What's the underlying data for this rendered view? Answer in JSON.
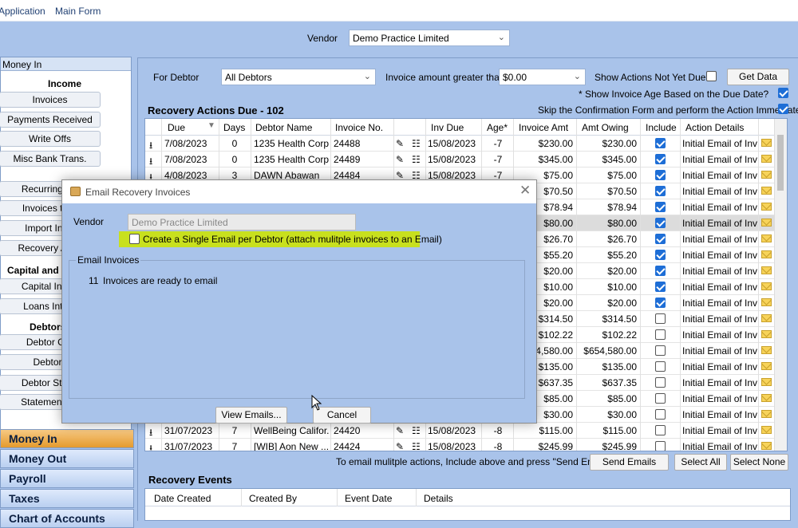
{
  "menubar": {
    "items": [
      "Application",
      "Main Form"
    ]
  },
  "vendor": {
    "label": "Vendor",
    "value": "Demo Practice Limited"
  },
  "sidebar": {
    "header": "Money In",
    "sections": [
      {
        "title": "Income",
        "items": [
          "Invoices",
          "Payments Received",
          "Write Offs",
          "Misc Bank Trans."
        ]
      },
      {
        "title": "",
        "items": [
          "Recurring Inv",
          "Invoices to C",
          "Import Invoi",
          "Recovery Actio"
        ]
      },
      {
        "title": "Capital and",
        "items": [
          "Capital Introd",
          "Loans Introd"
        ]
      },
      {
        "title": "Debtors",
        "items": [
          "Debtor Gro",
          "Debtors",
          "Debtor Stater",
          "Statement Ba"
        ]
      }
    ],
    "nav": [
      "Money In",
      "Money Out",
      "Payroll",
      "Taxes",
      "Chart of Accounts"
    ]
  },
  "filters": {
    "for_debtor_label": "For Debtor",
    "for_debtor_value": "All Debtors",
    "amount_label": "Invoice amount greater than",
    "amount_value": "$0.00",
    "show_not_due_label": "Show Actions Not Yet Due?",
    "get_data": "Get Data",
    "show_age_label": "* Show Invoice Age Based on the Due Date?",
    "skip_confirm_label": "Skip the Confirmation Form and perform the Action Immediately"
  },
  "recovery_title": "Recovery Actions Due - 102",
  "grid": {
    "columns": [
      "Due",
      "Days",
      "Debtor Name",
      "Invoice No.",
      "Inv Due",
      "Age*",
      "Invoice Amt",
      "Amt Owing",
      "Include",
      "Action Details"
    ],
    "rows": [
      {
        "due": "7/08/2023",
        "days": "0",
        "name": "1235 Health Corp...",
        "inv": "24488",
        "invdue": "15/08/2023",
        "age": "-7",
        "amt": "$230.00",
        "owing": "$230.00",
        "inc": true,
        "action": "Initial Email of Inv..."
      },
      {
        "due": "7/08/2023",
        "days": "0",
        "name": "1235 Health Corp...",
        "inv": "24489",
        "invdue": "15/08/2023",
        "age": "-7",
        "amt": "$345.00",
        "owing": "$345.00",
        "inc": true,
        "action": "Initial Email of Inv..."
      },
      {
        "due": "4/08/2023",
        "days": "3",
        "name": "DAWN Abawan",
        "inv": "24484",
        "invdue": "15/08/2023",
        "age": "-7",
        "amt": "$75.00",
        "owing": "$75.00",
        "inc": true,
        "action": "Initial Email of Inv..."
      },
      {
        "due": "",
        "days": "",
        "name": "",
        "inv": "",
        "invdue": "",
        "age": "",
        "amt": "$70.50",
        "owing": "$70.50",
        "inc": true,
        "action": "Initial Email of Inv..."
      },
      {
        "due": "",
        "days": "",
        "name": "",
        "inv": "",
        "invdue": "",
        "age": "",
        "amt": "$78.94",
        "owing": "$78.94",
        "inc": true,
        "action": "Initial Email of Inv..."
      },
      {
        "due": "",
        "days": "",
        "name": "",
        "inv": "",
        "invdue": "",
        "age": "",
        "amt": "$80.00",
        "owing": "$80.00",
        "inc": true,
        "action": "Initial Email of Inv..."
      },
      {
        "due": "",
        "days": "",
        "name": "",
        "inv": "",
        "invdue": "",
        "age": "",
        "amt": "$26.70",
        "owing": "$26.70",
        "inc": true,
        "action": "Initial Email of Inv..."
      },
      {
        "due": "",
        "days": "",
        "name": "",
        "inv": "",
        "invdue": "",
        "age": "",
        "amt": "$55.20",
        "owing": "$55.20",
        "inc": true,
        "action": "Initial Email of Inv..."
      },
      {
        "due": "",
        "days": "",
        "name": "",
        "inv": "",
        "invdue": "",
        "age": "",
        "amt": "$20.00",
        "owing": "$20.00",
        "inc": true,
        "action": "Initial Email of Inv..."
      },
      {
        "due": "",
        "days": "",
        "name": "",
        "inv": "",
        "invdue": "",
        "age": "",
        "amt": "$10.00",
        "owing": "$10.00",
        "inc": true,
        "action": "Initial Email of Inv..."
      },
      {
        "due": "",
        "days": "",
        "name": "",
        "inv": "",
        "invdue": "",
        "age": "",
        "amt": "$20.00",
        "owing": "$20.00",
        "inc": true,
        "action": "Initial Email of Inv..."
      },
      {
        "due": "",
        "days": "",
        "name": "",
        "inv": "",
        "invdue": "",
        "age": "",
        "amt": "$314.50",
        "owing": "$314.50",
        "inc": false,
        "action": "Initial Email of Inv..."
      },
      {
        "due": "",
        "days": "",
        "name": "",
        "inv": "",
        "invdue": "",
        "age": "",
        "amt": "$102.22",
        "owing": "$102.22",
        "inc": false,
        "action": "Initial Email of Inv..."
      },
      {
        "due": "",
        "days": "",
        "name": "",
        "inv": "",
        "invdue": "",
        "age": "",
        "amt": "$4,580.00",
        "owing": "$654,580.00",
        "inc": false,
        "action": "Initial Email of Inv..."
      },
      {
        "due": "",
        "days": "",
        "name": "",
        "inv": "",
        "invdue": "",
        "age": "",
        "amt": "$135.00",
        "owing": "$135.00",
        "inc": false,
        "action": "Initial Email of Inv..."
      },
      {
        "due": "",
        "days": "",
        "name": "",
        "inv": "",
        "invdue": "",
        "age": "",
        "amt": "$637.35",
        "owing": "$637.35",
        "inc": false,
        "action": "Initial Email of Inv..."
      },
      {
        "due": "",
        "days": "",
        "name": "",
        "inv": "",
        "invdue": "",
        "age": "",
        "amt": "$85.00",
        "owing": "$85.00",
        "inc": false,
        "action": "Initial Email of Inv..."
      },
      {
        "due": "",
        "days": "",
        "name": "",
        "inv": "",
        "invdue": "",
        "age": "",
        "amt": "$30.00",
        "owing": "$30.00",
        "inc": false,
        "action": "Initial Email of Inv..."
      },
      {
        "due": "31/07/2023",
        "days": "7",
        "name": "WellBeing Califor...",
        "inv": "24420",
        "invdue": "15/08/2023",
        "age": "-8",
        "amt": "$115.00",
        "owing": "$115.00",
        "inc": false,
        "action": "Initial Email of Inv..."
      },
      {
        "due": "31/07/2023",
        "days": "7",
        "name": "[WIB] Aon New ...",
        "inv": "24424",
        "invdue": "15/08/2023",
        "age": "-8",
        "amt": "$245.99",
        "owing": "$245.99",
        "inc": false,
        "action": "Initial Email of Inv..."
      }
    ]
  },
  "footer": {
    "hint": "To email mulitple actions, Include above and press \"Send Emails\"",
    "send": "Send Emails",
    "select_all": "Select All",
    "select_none": "Select None"
  },
  "events": {
    "title": "Recovery Events",
    "columns": [
      "Date Created",
      "Created By",
      "Event Date",
      "Details"
    ]
  },
  "dialog": {
    "title": "Email Recovery Invoices",
    "vendor_label": "Vendor",
    "vendor_value": "Demo Practice Limited",
    "single_email_label": "Create a Single Email per Debtor  (attach mulitple invoices to an Email)",
    "group_label": "Email Invoices",
    "count": "11",
    "ready_text": "Invoices are ready to email",
    "view_btn": "View Emails...",
    "cancel_btn": "Cancel"
  }
}
